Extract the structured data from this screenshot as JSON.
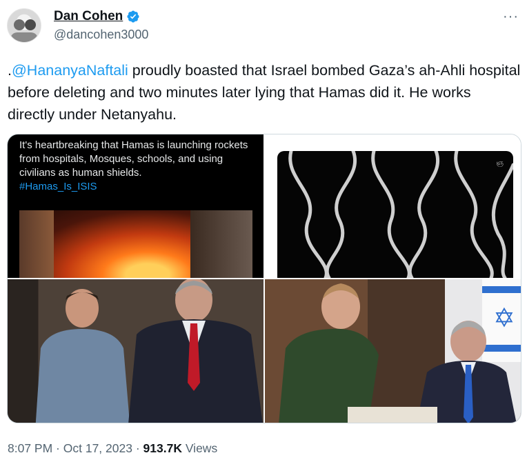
{
  "author": {
    "display_name": "Dan Cohen",
    "handle": "@dancohen3000",
    "verified": true,
    "verified_color": "#1d9bf0"
  },
  "tweet": {
    "prefix": ".",
    "mention": "@HananyaNaftali",
    "body": " proudly boasted that Israel bombed Gaza’s ah-Ahli hospital before deleting and two minutes later lying that Hamas did it. He works directly under Netanyahu."
  },
  "media": {
    "embedded_post_text": "It's heartbreaking that Hamas is launching rockets from hospitals, Mosques, schools, and using civilians as human shields.",
    "embedded_post_hashtag": "#Hamas_Is_ISIS",
    "watermark": "ஞ"
  },
  "meta": {
    "time": "8:07 PM",
    "separator": " · ",
    "date": "Oct 17, 2023",
    "views_count": "913.7K",
    "views_label": " Views"
  },
  "icons": {
    "more": "more-options-icon",
    "verified": "verified-badge-icon"
  },
  "colors": {
    "link": "#1d9bf0",
    "secondary_text": "#536471",
    "primary_text": "#0f1419"
  }
}
